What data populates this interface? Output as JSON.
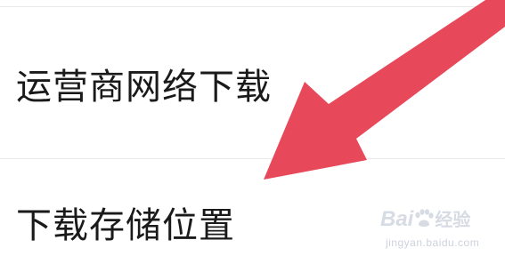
{
  "settings": {
    "items": [
      {
        "label": "运营商网络下载"
      },
      {
        "label": "下载存储位置"
      }
    ]
  },
  "annotation": {
    "arrow_color": "#e8495a",
    "arrow_icon": "pointing-arrow-icon"
  },
  "watermark": {
    "logo_text": "Bai",
    "logo_suffix": "经验",
    "url": "jingyan.baidu.com",
    "paw_icon": "baidu-paw-icon"
  }
}
